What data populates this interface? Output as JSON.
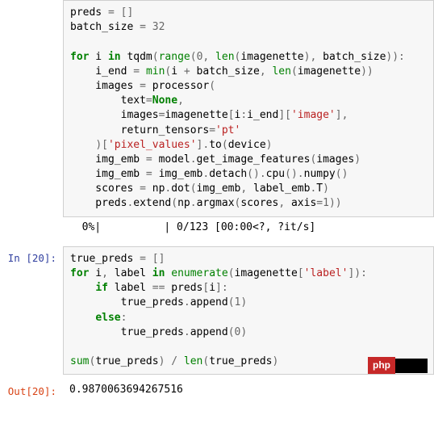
{
  "cell1": {
    "l1": {
      "a": "preds ",
      "b": "=",
      "c": " ",
      "d": "[",
      "e": "]"
    },
    "l2": {
      "a": "batch_size ",
      "b": "=",
      "c": " ",
      "d": "32"
    },
    "l4": {
      "a": "for",
      "b": " i ",
      "c": "in",
      "d": " tqdm",
      "e": "(",
      "f": "range",
      "g": "(",
      "h": "0",
      "i": ",",
      "j": " ",
      "k": "len",
      "l": "(",
      "m": "imagenette",
      "n": ")",
      "o": ",",
      "p": " batch_size",
      "q": ")",
      "r": ")",
      "s": ":"
    },
    "l5": {
      "a": "    i_end ",
      "b": "=",
      "c": " ",
      "d": "min",
      "e": "(",
      "f": "i ",
      "g": "+",
      "h": " batch_size",
      "i": ",",
      "j": " ",
      "k": "len",
      "l": "(",
      "m": "imagenette",
      "n": ")",
      "o": ")"
    },
    "l6": {
      "a": "    images ",
      "b": "=",
      "c": " processor",
      "d": "("
    },
    "l7": {
      "a": "        text",
      "b": "=",
      "c": "None",
      "d": ","
    },
    "l8": {
      "a": "        images",
      "b": "=",
      "c": "imagenette",
      "d": "[",
      "e": "i",
      "f": ":",
      "g": "i_end",
      "h": "]",
      "i": "[",
      "j": "'image'",
      "k": "]",
      "l": ","
    },
    "l9": {
      "a": "        return_tensors",
      "b": "=",
      "c": "'pt'"
    },
    "l10": {
      "a": "    ",
      "b": ")",
      "c": "[",
      "d": "'pixel_values'",
      "e": "]",
      "f": ".",
      "g": "to",
      "h": "(",
      "i": "device",
      "j": ")"
    },
    "l11": {
      "a": "    img_emb ",
      "b": "=",
      "c": " model",
      "d": ".",
      "e": "get_image_features",
      "f": "(",
      "g": "images",
      "h": ")"
    },
    "l12": {
      "a": "    img_emb ",
      "b": "=",
      "c": " img_emb",
      "d": ".",
      "e": "detach",
      "f": "()",
      "g": ".",
      "h": "cpu",
      "i": "()",
      "j": ".",
      "k": "numpy",
      "l": "()"
    },
    "l13": {
      "a": "    scores ",
      "b": "=",
      "c": " np",
      "d": ".",
      "e": "dot",
      "f": "(",
      "g": "img_emb",
      "h": ",",
      "i": " label_emb",
      "j": ".",
      "k": "T",
      "l": ")"
    },
    "l14": {
      "a": "    preds",
      "b": ".",
      "c": "extend",
      "d": "(",
      "e": "np",
      "f": ".",
      "g": "argmax",
      "h": "(",
      "i": "scores",
      "j": ",",
      "k": " axis",
      "l": "=",
      "m": "1",
      "n": ")",
      "o": ")"
    }
  },
  "out1": "  0%|          | 0/123 [00:00<?, ?it/s]",
  "prompt_in20": "In [20]:",
  "cell2": {
    "l1": {
      "a": "true_preds ",
      "b": "=",
      "c": " ",
      "d": "[",
      "e": "]"
    },
    "l2": {
      "a": "for",
      "b": " i",
      "c": ",",
      "d": " label ",
      "e": "in",
      "f": " ",
      "g": "enumerate",
      "h": "(",
      "i": "imagenette",
      "j": "[",
      "k": "'label'",
      "l": "]",
      "m": ")",
      "n": ":"
    },
    "l3": {
      "a": "    ",
      "b": "if",
      "c": " label ",
      "d": "==",
      "e": " preds",
      "f": "[",
      "g": "i",
      "h": "]",
      "i": ":"
    },
    "l4": {
      "a": "        true_preds",
      "b": ".",
      "c": "append",
      "d": "(",
      "e": "1",
      "f": ")"
    },
    "l5": {
      "a": "    ",
      "b": "else",
      "c": ":"
    },
    "l6": {
      "a": "        true_preds",
      "b": ".",
      "c": "append",
      "d": "(",
      "e": "0",
      "f": ")"
    },
    "l8": {
      "a": "sum",
      "b": "(",
      "c": "true_preds",
      "d": ")",
      "e": " ",
      "f": "/",
      "g": " ",
      "h": "len",
      "i": "(",
      "j": "true_preds",
      "k": ")"
    }
  },
  "prompt_out20": "Out[20]:",
  "out20_value": "0.9870063694267516",
  "watermark": "php"
}
